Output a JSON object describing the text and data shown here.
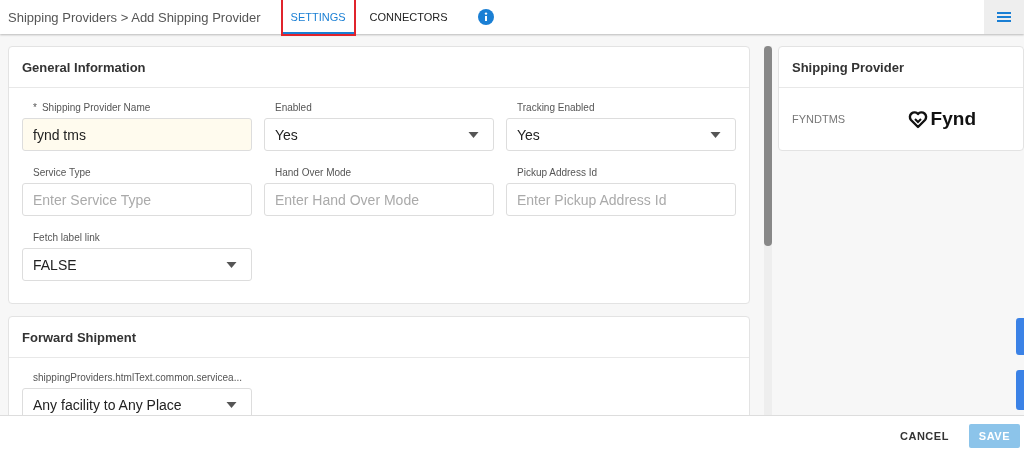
{
  "breadcrumb": {
    "parent": "Shipping Providers",
    "separator": ">",
    "current": "Add Shipping Provider"
  },
  "tabs": [
    {
      "label": "SETTINGS",
      "selected": true,
      "highlighted": true
    },
    {
      "label": "CONNECTORS",
      "selected": false,
      "highlighted": false
    }
  ],
  "sections": [
    {
      "title": "General Information",
      "fields": [
        {
          "kind": "input",
          "label": "Shipping Provider Name",
          "required_mark": "*",
          "value": "fynd tms"
        },
        {
          "kind": "select",
          "label": "Enabled",
          "value": "Yes"
        },
        {
          "kind": "select",
          "label": "Tracking Enabled",
          "value": "Yes"
        },
        {
          "kind": "input",
          "label": "Service Type",
          "placeholder": "Enter Service Type"
        },
        {
          "kind": "input",
          "label": "Hand Over Mode",
          "placeholder": "Enter Hand Over Mode"
        },
        {
          "kind": "input",
          "label": "Pickup Address Id",
          "placeholder": "Enter Pickup Address Id"
        },
        {
          "kind": "select",
          "label": "Fetch label link",
          "value": "FALSE"
        }
      ]
    },
    {
      "title": "Forward Shipment",
      "fields": [
        {
          "kind": "select",
          "label": "shippingProviders.htmlText.common.servicea...",
          "value": "Any facility to Any Place"
        }
      ]
    }
  ],
  "summary": {
    "title": "Shipping Provider",
    "code": "FYNDTMS",
    "logo_text": "Fynd"
  },
  "footer": {
    "buttons": [
      {
        "label": "CANCEL",
        "kind": "text",
        "disabled": false
      },
      {
        "label": "SAVE",
        "kind": "primary",
        "disabled": true
      }
    ]
  }
}
